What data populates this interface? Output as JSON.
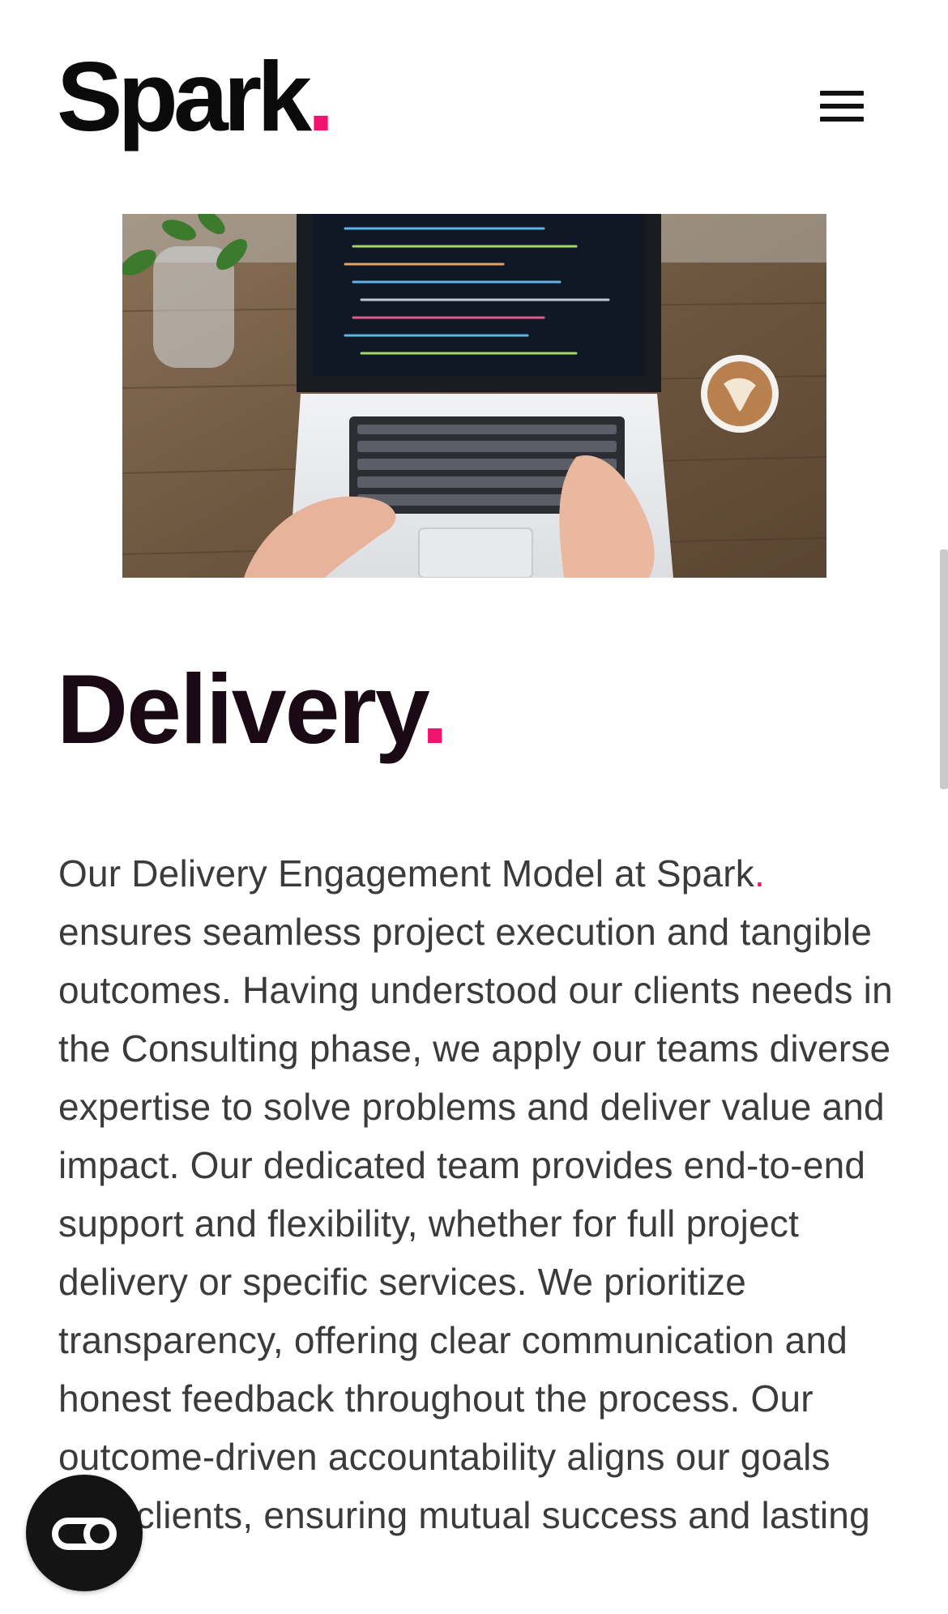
{
  "header": {
    "logo_text": "Spark",
    "logo_dot": ".",
    "menu_icon": "hamburger-menu-icon"
  },
  "hero": {
    "icon": "laptop-desk-photo"
  },
  "section": {
    "title": "Delivery",
    "title_dot": ".",
    "body_part1": "Our Delivery Engagement Model at Spark",
    "body_dot": ".",
    "body_part2": " ensures seamless project execution and tangible outcomes. Having understood our clients needs in the Consulting phase, we apply our teams diverse expertise to solve problems and deliver value and impact. Our dedicated team provides end-to-end support and flexibility, whether for full project delivery or specific services. We prioritize transparency, offering clear communication and honest feedback throughout the process. Our outcome-driven accountability aligns our goals with clients, ensuring mutual success and lasting"
  },
  "fab": {
    "icon": "toggle-switch-icon"
  },
  "colors": {
    "accent": "#f0146e",
    "heading": "#1a0a14",
    "body": "#3b3b3b",
    "fab_bg": "#141414"
  }
}
